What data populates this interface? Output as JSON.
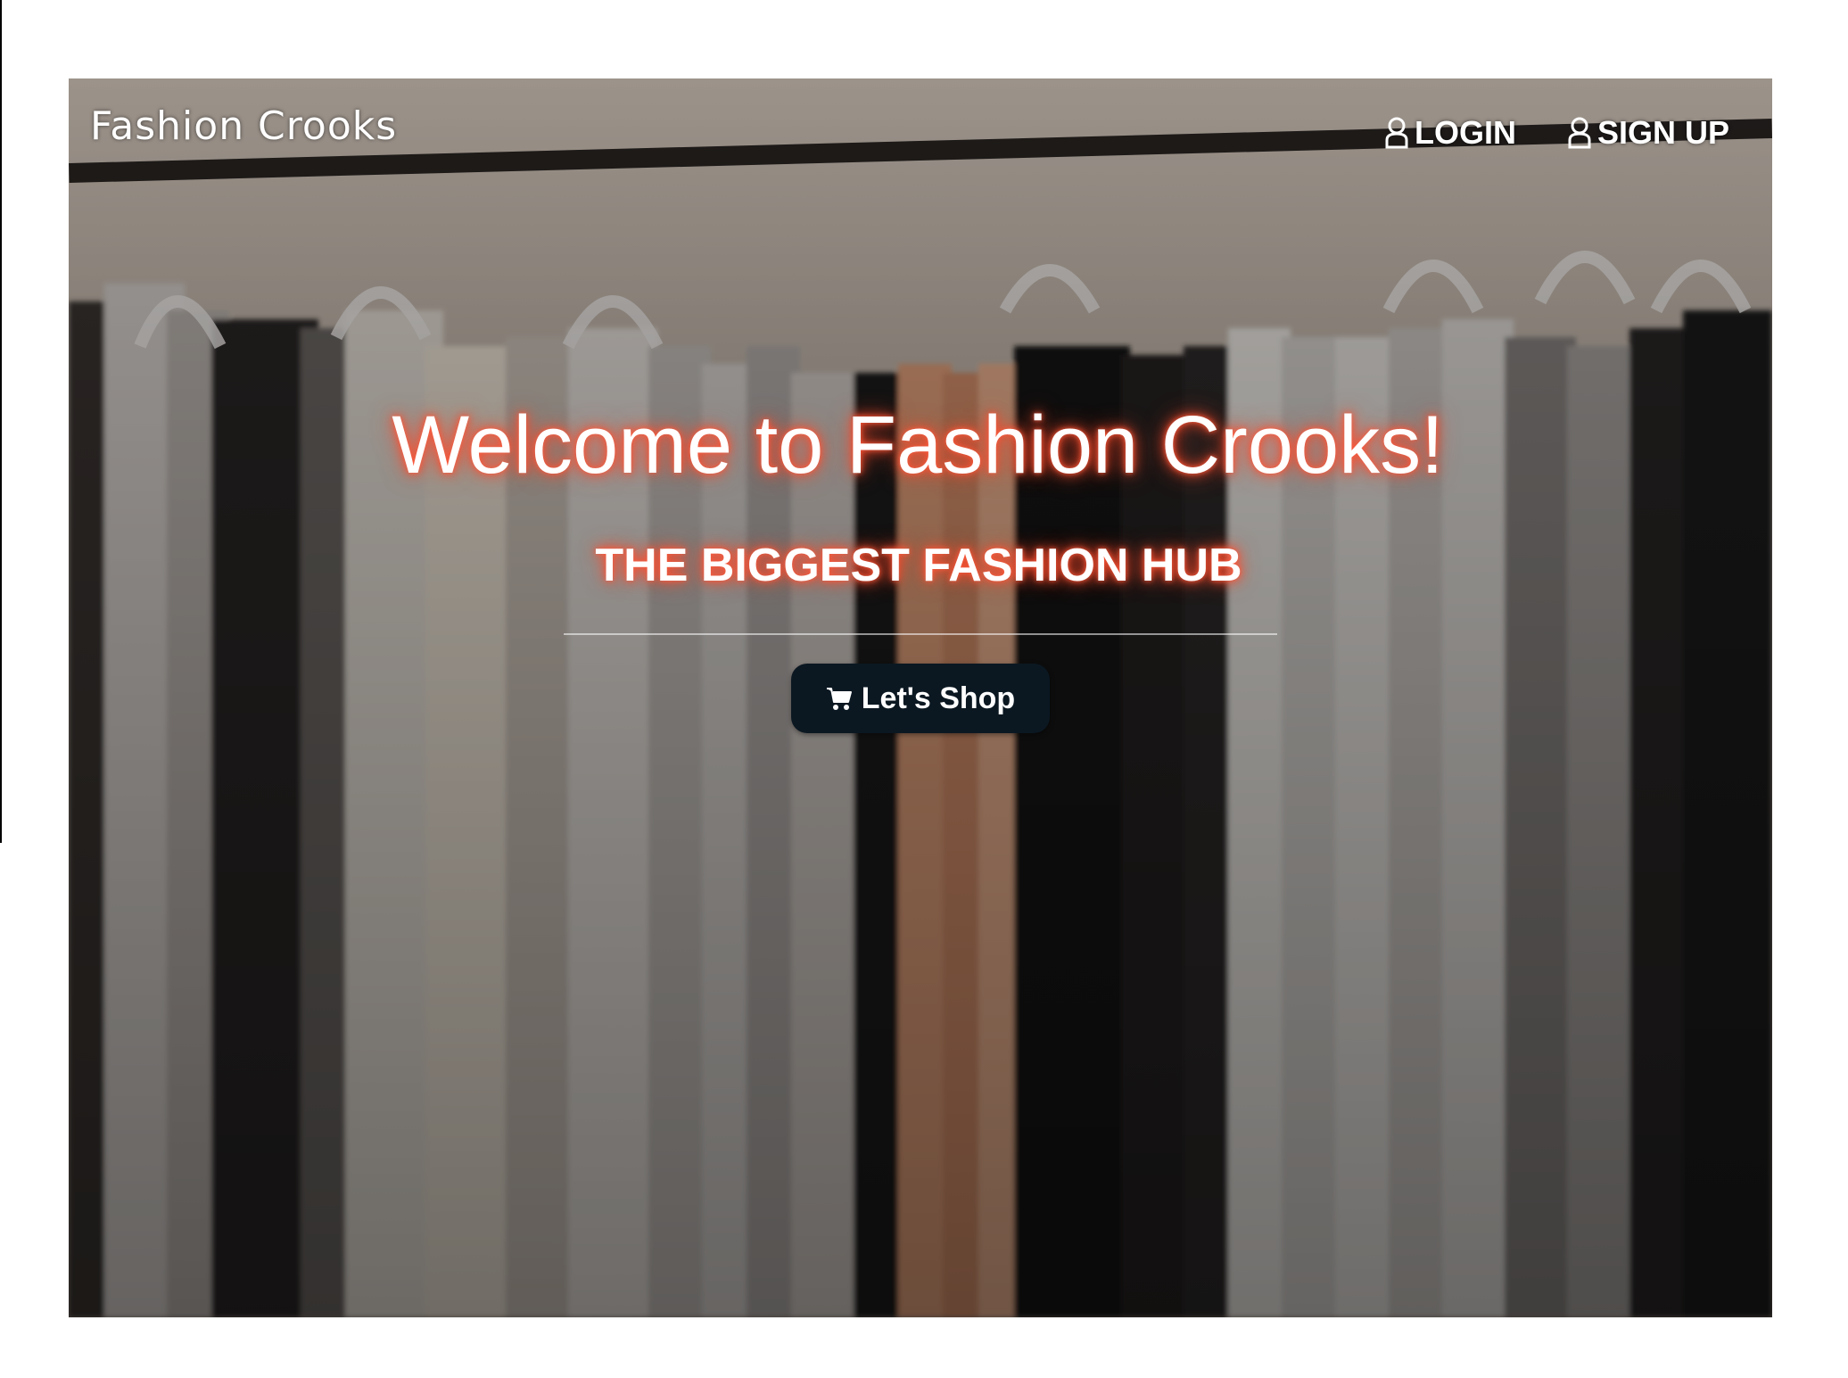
{
  "navbar": {
    "brand": "Fashion Crooks",
    "login_label": "LOGIN",
    "signup_label": "SIGN UP",
    "login_icon": "user-icon",
    "signup_icon": "user-icon"
  },
  "hero": {
    "headline": "Welcome to Fashion Crooks!",
    "subheadline": "THE BIGGEST FASHION HUB",
    "cta_label": "Let's Shop",
    "cta_icon": "cart-icon",
    "background": "clothes-rack-photo"
  },
  "colors": {
    "glow": "#ff4a2a",
    "button_bg": "#0b1822",
    "text": "#ffffff"
  }
}
